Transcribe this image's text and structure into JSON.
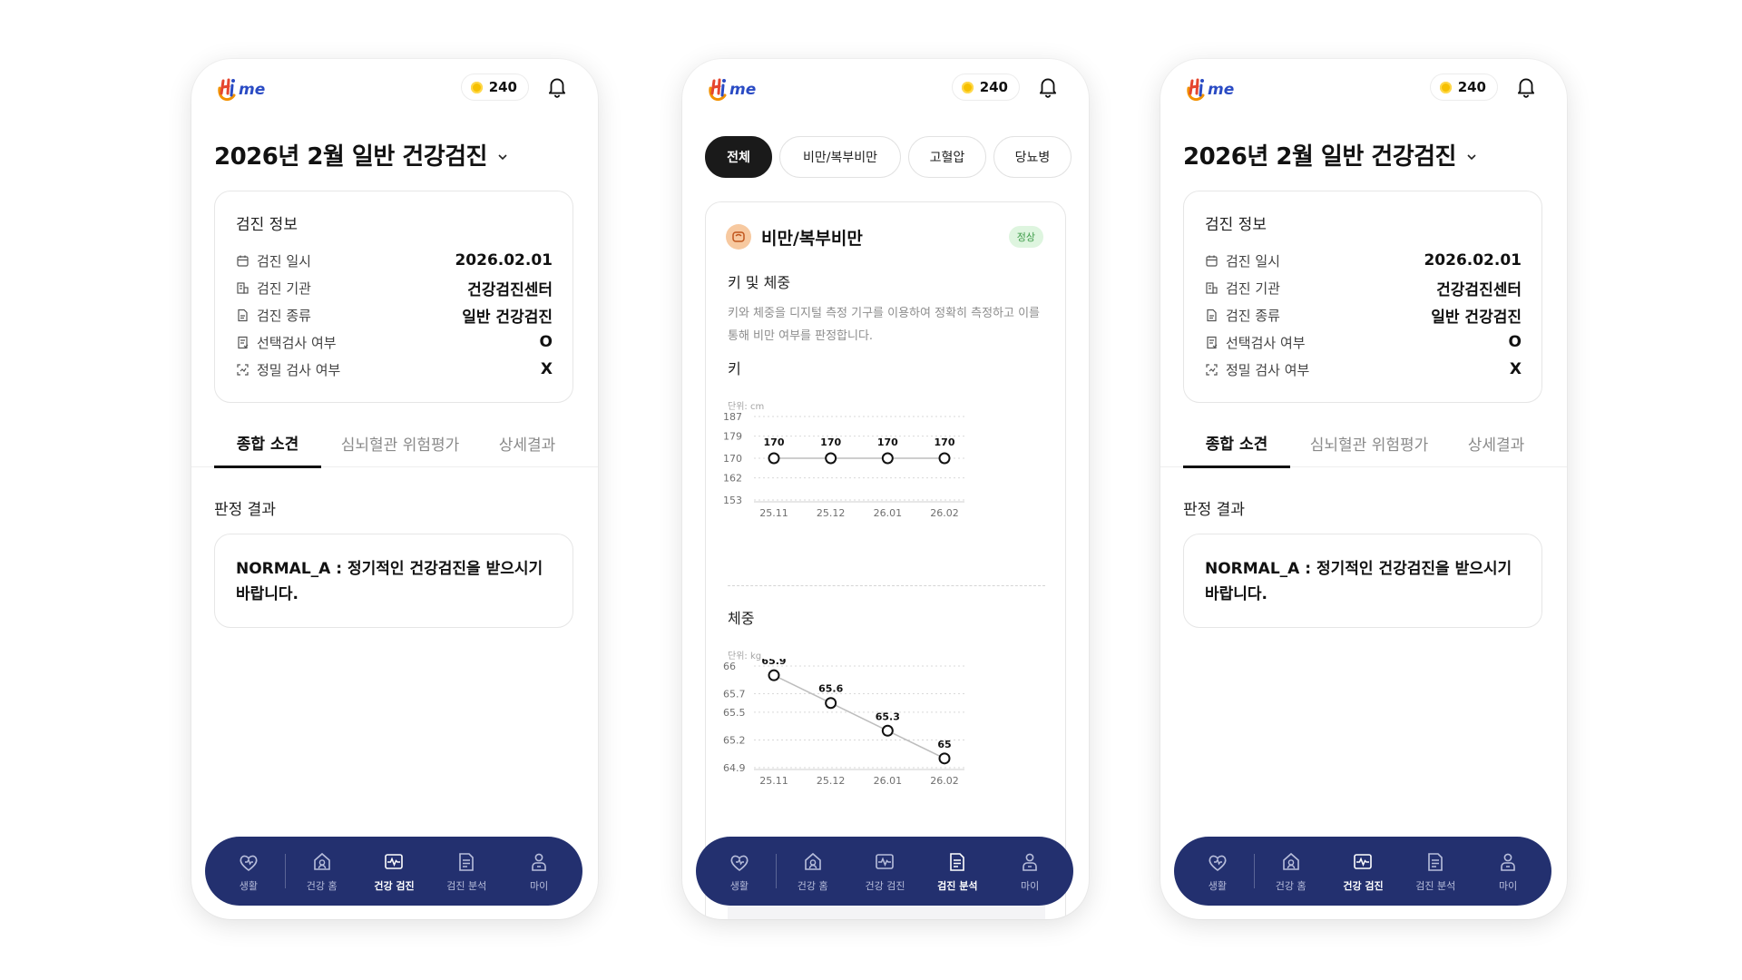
{
  "header": {
    "logo_text": "Hi me",
    "points": "240"
  },
  "summary": {
    "title": "2026년 2월 일반 건강검진",
    "info_heading": "검진 정보",
    "info_rows": [
      {
        "label": "검진 일시",
        "value": "2026.02.01",
        "icon": "calendar-icon"
      },
      {
        "label": "검진 기관",
        "value": "건강검진센터",
        "icon": "building-icon"
      },
      {
        "label": "검진 종류",
        "value": "일반 건강검진",
        "icon": "document-icon"
      },
      {
        "label": "선택검사 여부",
        "value": "O",
        "icon": "checklist-icon"
      },
      {
        "label": "정밀 검사 여부",
        "value": "X",
        "icon": "scan-icon"
      }
    ],
    "tabs": [
      "종합 소견",
      "심뇌혈관 위험평가",
      "상세결과"
    ],
    "active_tab": "종합 소견",
    "verdict_heading": "판정 결과",
    "verdict_text": "NORMAL_A : 정기적인 건강검진을 받으시기 바랍니다."
  },
  "analysis": {
    "chips": [
      "전체",
      "비만/복부비만",
      "고혈압",
      "당뇨병"
    ],
    "active_chip": "전체",
    "card_title": "비만/복부비만",
    "badge": "정상",
    "badge_color": "#3d9b48",
    "subtitle": "키 및 체중",
    "description": "키와 체중을 디지털 측정 기구를 이용하여 정확히 측정하고 이를 통해 비만 여부를 판정합니다.",
    "height_label": "키",
    "weight_label": "체중"
  },
  "chart_data": [
    {
      "type": "line",
      "title": "키",
      "unit_label": "단위: cm",
      "x": [
        "25.11",
        "25.12",
        "26.01",
        "26.02"
      ],
      "y_ticks": [
        187,
        179,
        170,
        162,
        153
      ],
      "ylim": [
        153,
        187
      ],
      "values": [
        170,
        170,
        170,
        170
      ],
      "grid": true
    },
    {
      "type": "line",
      "title": "체중",
      "unit_label": "단위: kg",
      "x": [
        "25.11",
        "25.12",
        "26.01",
        "26.02"
      ],
      "y_ticks": [
        66,
        65.7,
        65.5,
        65.2,
        64.9
      ],
      "ylim": [
        64.9,
        66
      ],
      "values": [
        65.9,
        65.6,
        65.3,
        65
      ],
      "grid": true
    }
  ],
  "bottom_nav": {
    "items": [
      "생활",
      "건강 홈",
      "건강 검진",
      "검진 분석",
      "마이"
    ],
    "icons": [
      "heart-icon",
      "home-icon",
      "pulse-icon",
      "report-icon",
      "user-icon"
    ],
    "active_summary": "건강 검진",
    "active_analysis": "검진 분석"
  },
  "colors": {
    "nav_bg": "#23306f",
    "point_coin": "#f6c000",
    "logo_orange": "#f29100",
    "logo_blue": "#2a4bc4"
  }
}
